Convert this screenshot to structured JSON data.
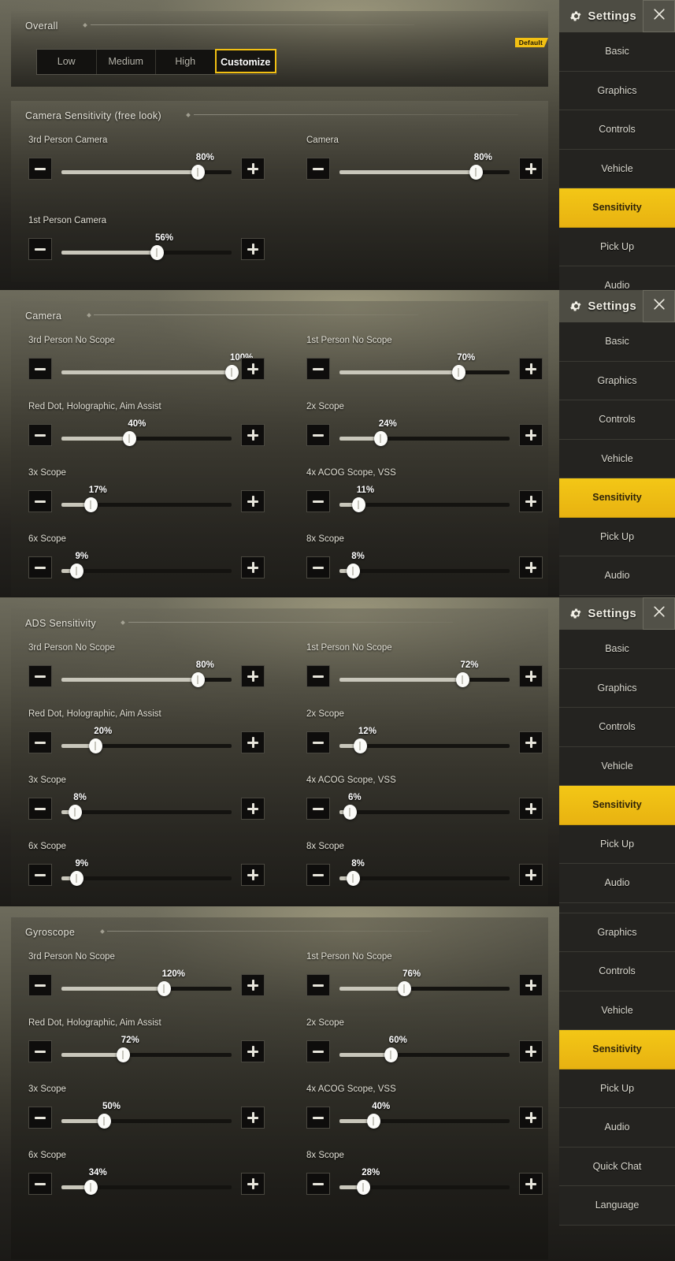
{
  "sidebar": {
    "title": "Settings",
    "gear_icon": "gear-icon",
    "close_icon": "close-icon",
    "active_item": "Sensitivity",
    "accent_color": "#f2c013",
    "items": [
      "Basic",
      "Graphics",
      "Controls",
      "Vehicle",
      "Sensitivity",
      "Pick Up",
      "Audio",
      "Quick Chat",
      "Language"
    ]
  },
  "panels": [
    {
      "overall": {
        "title": "Overall",
        "presets": [
          "Low",
          "Medium",
          "High",
          "Customize"
        ],
        "selected": "Customize",
        "default_badge": "Default"
      },
      "section": {
        "title": "Camera Sensitivity (free look)",
        "rows": [
          {
            "label": "3rd Person Camera",
            "value": "80%",
            "percent": 80
          },
          {
            "label": "Camera",
            "value": "80%",
            "percent": 80
          },
          {
            "label": "1st Person Camera",
            "value": "56%",
            "percent": 56
          }
        ]
      }
    },
    {
      "section": {
        "title": "Camera",
        "rows": [
          {
            "label": "3rd Person No Scope",
            "value": "100%",
            "percent": 100
          },
          {
            "label": "1st Person No Scope",
            "value": "70%",
            "percent": 70
          },
          {
            "label": "Red Dot, Holographic, Aim Assist",
            "value": "40%",
            "percent": 40
          },
          {
            "label": "2x Scope",
            "value": "24%",
            "percent": 24
          },
          {
            "label": "3x Scope",
            "value": "17%",
            "percent": 17
          },
          {
            "label": "4x ACOG Scope, VSS",
            "value": "11%",
            "percent": 11
          },
          {
            "label": "6x Scope",
            "value": "9%",
            "percent": 9
          },
          {
            "label": "8x Scope",
            "value": "8%",
            "percent": 8
          }
        ]
      }
    },
    {
      "section": {
        "title": "ADS Sensitivity",
        "rows": [
          {
            "label": "3rd Person No Scope",
            "value": "80%",
            "percent": 80
          },
          {
            "label": "1st Person No Scope",
            "value": "72%",
            "percent": 72
          },
          {
            "label": "Red Dot, Holographic, Aim Assist",
            "value": "20%",
            "percent": 20
          },
          {
            "label": "2x Scope",
            "value": "12%",
            "percent": 12
          },
          {
            "label": "3x Scope",
            "value": "8%",
            "percent": 8
          },
          {
            "label": "4x ACOG Scope, VSS",
            "value": "6%",
            "percent": 6
          },
          {
            "label": "6x Scope",
            "value": "9%",
            "percent": 9
          },
          {
            "label": "8x Scope",
            "value": "8%",
            "percent": 8
          }
        ]
      }
    },
    {
      "section": {
        "title": "Gyroscope",
        "rows": [
          {
            "label": "3rd Person No Scope",
            "value": "120%",
            "percent": 60
          },
          {
            "label": "1st Person No Scope",
            "value": "76%",
            "percent": 38
          },
          {
            "label": "Red Dot, Holographic, Aim Assist",
            "value": "72%",
            "percent": 36
          },
          {
            "label": "2x Scope",
            "value": "60%",
            "percent": 30
          },
          {
            "label": "3x Scope",
            "value": "50%",
            "percent": 25
          },
          {
            "label": "4x ACOG Scope, VSS",
            "value": "40%",
            "percent": 20
          },
          {
            "label": "6x Scope",
            "value": "34%",
            "percent": 17
          },
          {
            "label": "8x Scope",
            "value": "28%",
            "percent": 14
          }
        ]
      }
    }
  ]
}
